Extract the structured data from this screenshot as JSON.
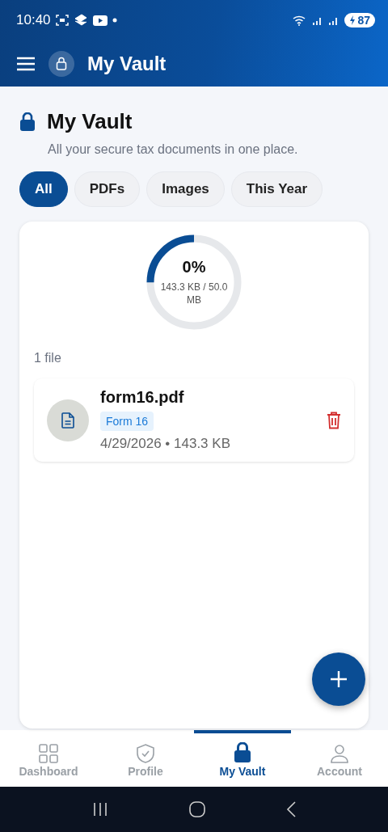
{
  "status_bar": {
    "time": "10:40",
    "battery": "87"
  },
  "app_bar": {
    "title": "My Vault"
  },
  "header": {
    "title": "My Vault",
    "subtitle": "All your secure tax documents in one place."
  },
  "filters": [
    {
      "label": "All",
      "selected": true
    },
    {
      "label": "PDFs",
      "selected": false
    },
    {
      "label": "Images",
      "selected": false
    },
    {
      "label": "This Year",
      "selected": false
    }
  ],
  "storage": {
    "percent": "0%",
    "usage": "143.3 KB / 50.0 MB",
    "level": 0.25
  },
  "file_count": "1 file",
  "files": [
    {
      "name": "form16.pdf",
      "tag": "Form 16",
      "meta": "4/29/2026 • 143.3 KB"
    }
  ],
  "bottom_nav": [
    {
      "label": "Dashboard",
      "selected": false
    },
    {
      "label": "Profile",
      "selected": false
    },
    {
      "label": "My Vault",
      "selected": true
    },
    {
      "label": "Account",
      "selected": false
    }
  ]
}
